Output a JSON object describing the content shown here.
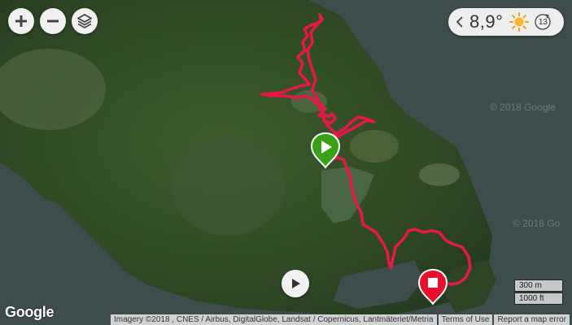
{
  "controls": {
    "zoom_in_icon": "plus-icon",
    "zoom_out_icon": "minus-icon",
    "layers_icon": "layers-icon",
    "play_icon": "play-icon"
  },
  "weather": {
    "temperature": "8,9°",
    "wind_speed": "13",
    "icon": "sun-icon"
  },
  "markers": {
    "start_color": "#3aa017",
    "end_color": "#e8102a"
  },
  "route": {
    "color": "#e8174a"
  },
  "scale": {
    "metric": "300 m",
    "imperial": "1000 ft"
  },
  "attribution": {
    "imagery": "Imagery ©2018 , CNES / Airbus, DigitalGlobe, Landsat / Copernicus, Lantmäteriet/Metria",
    "terms": "Terms of Use",
    "report": "Report a map error"
  },
  "branding": {
    "logo": "Google",
    "watermark_1": "© 2018 Google",
    "watermark_2": "© 2018 Go"
  }
}
